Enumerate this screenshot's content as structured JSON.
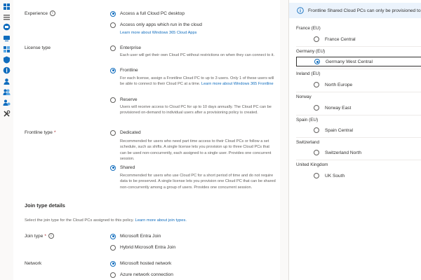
{
  "nav": {
    "icons": [
      "grid-icon",
      "list-icon",
      "cloud-pc-icon",
      "devices-icon",
      "apps-icon",
      "endpoint-security-icon",
      "reports-icon",
      "users-icon",
      "groups-icon",
      "tenant-admin-icon",
      "troubleshooting-icon"
    ],
    "accent": "#0f6cbd"
  },
  "experience": {
    "label": "Experience",
    "options": [
      {
        "label": "Access a full Cloud PC desktop",
        "selected": true
      },
      {
        "label": "Access only apps which run in the cloud",
        "selected": false
      }
    ],
    "link": "Learn more about Windows 365 Cloud Apps"
  },
  "license_type": {
    "label": "License type",
    "enterprise": {
      "label": "Enterprise",
      "selected": false,
      "desc": "Each user will get their own Cloud PC without restrictions on when they can connect to it."
    },
    "frontline": {
      "label": "Frontline",
      "selected": true,
      "desc": "For each license, assign a Frontline Cloud PC to up to 3 users. Only 1 of these users will be able to connect to their Cloud PC at a time.",
      "link": "Learn more about Windows 365 Frontline"
    },
    "reserve": {
      "label": "Reserve",
      "selected": false,
      "desc": "Users will receive access to Cloud PC for up to 10 days annually. The Cloud PC can be provisioned on-demand to individual users after a provisioning policy is created."
    }
  },
  "frontline_type": {
    "label": "Frontline type",
    "required": "*",
    "dedicated": {
      "label": "Dedicated",
      "selected": false,
      "desc": "Recommended for users who need part time access to their Cloud PCs or follow a set schedule, such as shifts. A single license lets you provision up to three Cloud PCs that can be used non-concurrently, each assigned to a single user. Provides one concurrent session."
    },
    "shared": {
      "label": "Shared",
      "selected": true,
      "desc": "Recommended for users who use Cloud PC for a short period of time and do not require data to be preserved. A single license lets you provision one Cloud PC that can be shared non-concurrently among a group of users. Provides one concurrent session."
    }
  },
  "join_type_details": {
    "title": "Join type details",
    "desc": "Select the join type for the Cloud PCs assigned to this policy.",
    "link": "Learn more about join types."
  },
  "join_type": {
    "label": "Join type",
    "required": "*",
    "options": [
      {
        "label": "Microsoft Entra Join",
        "selected": true
      },
      {
        "label": "Hybrid Microsoft Entra Join",
        "selected": false
      }
    ]
  },
  "network": {
    "label": "Network",
    "options": [
      {
        "label": "Microsoft hosted network",
        "selected": true
      },
      {
        "label": "Azure network connection",
        "selected": false
      }
    ]
  },
  "right_panel": {
    "banner": "Frontline Shared Cloud PCs can only be provisioned to",
    "regions": [
      {
        "name": "France (EU)",
        "site": "France Central",
        "selected": false
      },
      {
        "name": "Germany (EU)",
        "site": "Germany West Central",
        "selected": true
      },
      {
        "name": "Ireland (EU)",
        "site": "North Europe",
        "selected": false
      },
      {
        "name": "Norway",
        "site": "Norway East",
        "selected": false
      },
      {
        "name": "Spain (EU)",
        "site": "Spain Central",
        "selected": false
      },
      {
        "name": "Switzerland",
        "site": "Switzerland North",
        "selected": false
      },
      {
        "name": "United Kingdom",
        "site": "UK South",
        "selected": false
      }
    ]
  }
}
